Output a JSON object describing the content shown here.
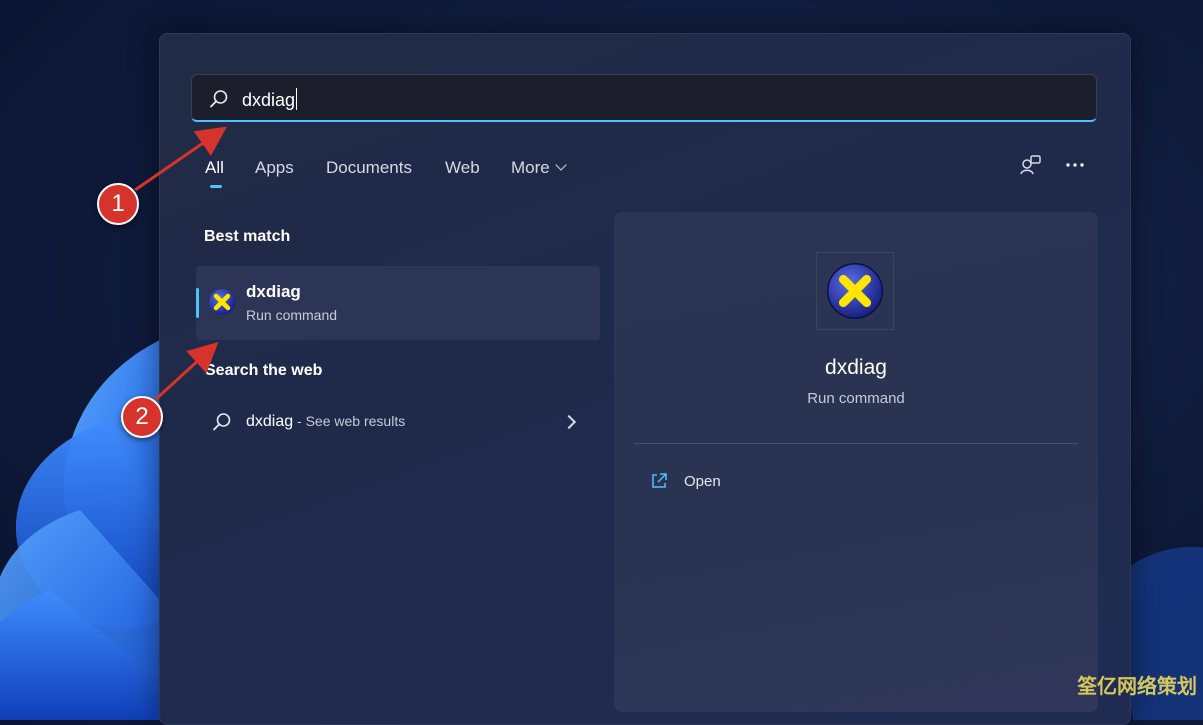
{
  "search": {
    "query": "dxdiag"
  },
  "tabs": [
    {
      "label": "All",
      "active": true
    },
    {
      "label": "Apps"
    },
    {
      "label": "Documents"
    },
    {
      "label": "Web"
    },
    {
      "label": "More"
    }
  ],
  "icons": {
    "search": "search-icon",
    "more_chevron": "chevron-down-icon",
    "switch_account": "account-switch-icon",
    "ellipsis": "more-options-icon",
    "app": "dxdiag-app-icon",
    "web_chevron": "chevron-right-icon",
    "open": "open-external-icon"
  },
  "best_match": {
    "heading": "Best match",
    "name": "dxdiag",
    "type": "Run command"
  },
  "web_search": {
    "heading": "Search the web",
    "query": "dxdiag",
    "suffix": " - See web results"
  },
  "detail": {
    "title": "dxdiag",
    "subtitle": "Run command",
    "actions": [
      {
        "label": "Open"
      }
    ]
  },
  "annotations": {
    "marker_1": "1",
    "marker_2": "2"
  },
  "watermark": "筌亿网络策划",
  "colors": {
    "accent": "#4cc2ff",
    "marker": "#d6332c"
  }
}
